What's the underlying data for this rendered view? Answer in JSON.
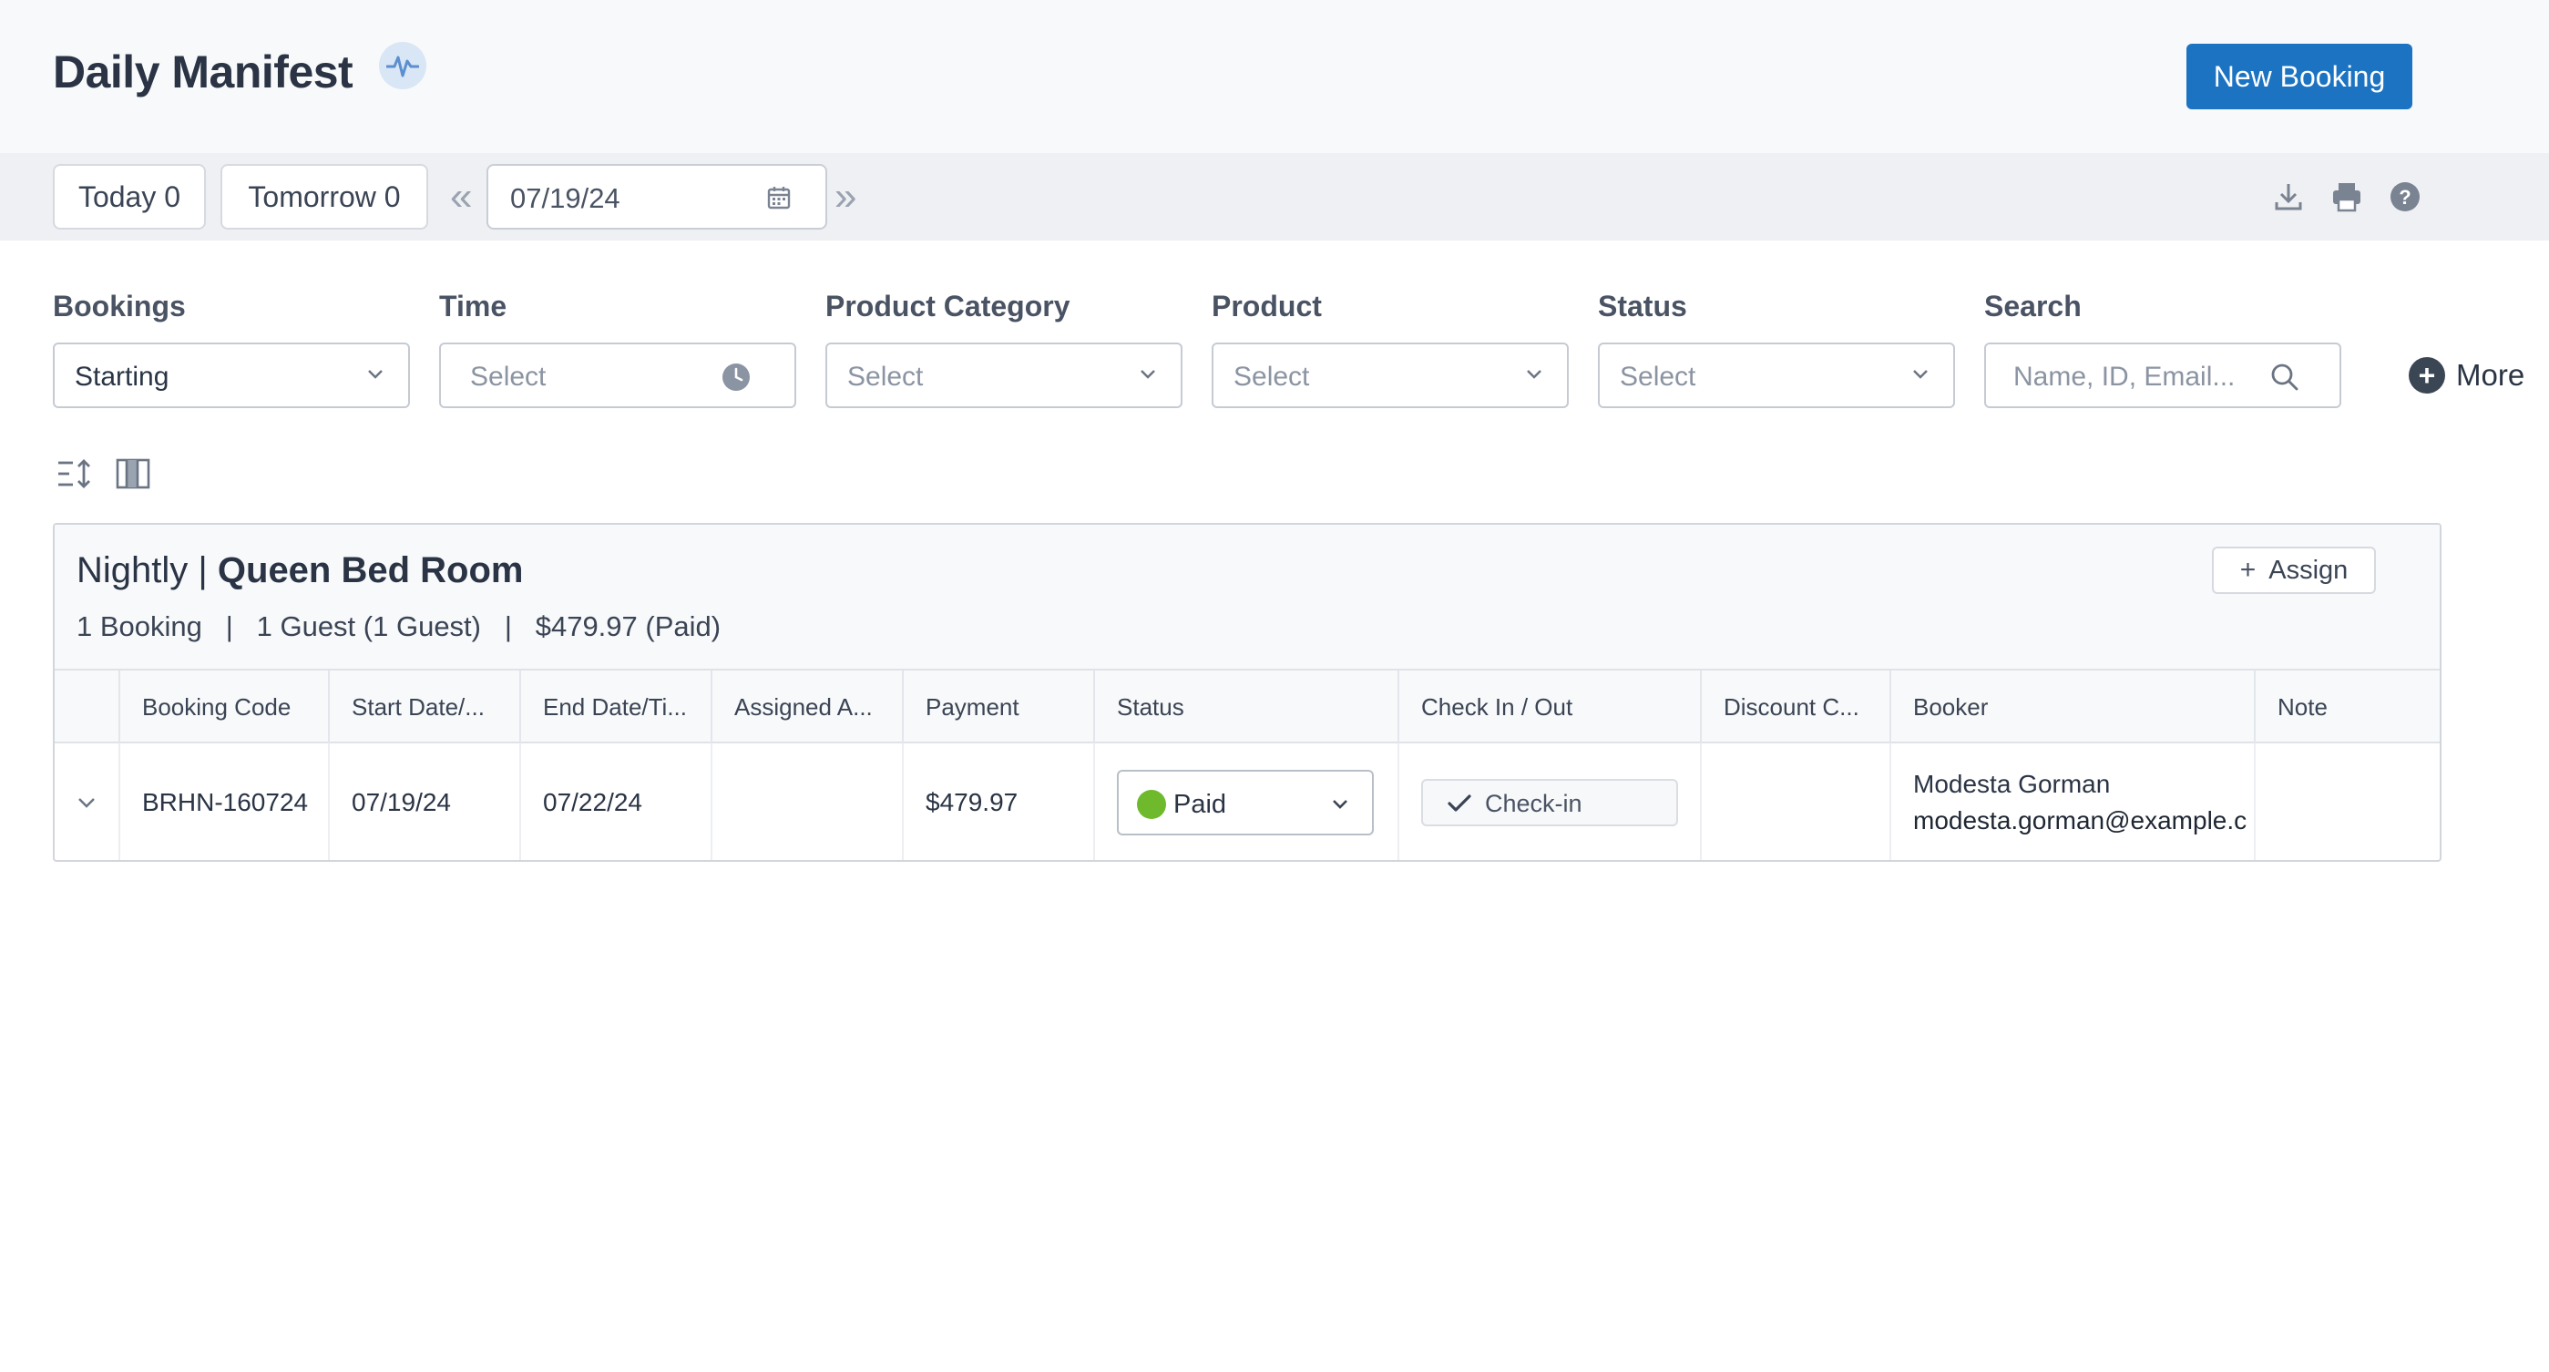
{
  "header": {
    "title": "Daily Manifest",
    "new_booking_label": "New Booking"
  },
  "toolbar": {
    "today_label": "Today 0",
    "tomorrow_label": "Tomorrow 0",
    "prev_label": "«",
    "next_label": "»",
    "date_value": "07/19/24"
  },
  "filters": {
    "bookings": {
      "label": "Bookings",
      "value": "Starting"
    },
    "time": {
      "label": "Time",
      "placeholder": "Select"
    },
    "product_category": {
      "label": "Product Category",
      "placeholder": "Select"
    },
    "product": {
      "label": "Product",
      "placeholder": "Select"
    },
    "status": {
      "label": "Status",
      "placeholder": "Select"
    },
    "search": {
      "label": "Search",
      "placeholder": "Name, ID, Email..."
    },
    "more_label": "More"
  },
  "group": {
    "title_prefix": "Nightly | ",
    "title_name": "Queen Bed Room",
    "summary": "1 Booking   |   1 Guest (1 Guest)   |   $479.97 (Paid)",
    "assign_label": "Assign",
    "columns": [
      "Booking Code",
      "Start Date/...",
      "End Date/Ti...",
      "Assigned A...",
      "Payment",
      "Status",
      "Check In / Out",
      "Discount C...",
      "Booker",
      "Note"
    ],
    "rows": [
      {
        "booking_code": "BRHN-160724",
        "start_date": "07/19/24",
        "end_date": "07/22/24",
        "assigned": "",
        "payment": "$479.97",
        "status": "Paid",
        "checkin_label": "Check-in",
        "discount": "",
        "booker_name": "Modesta Gorman",
        "booker_email": "modesta.gorman@example.c",
        "note": ""
      }
    ]
  },
  "colors": {
    "primary": "#1b73c2",
    "paid": "#6fba2c"
  }
}
